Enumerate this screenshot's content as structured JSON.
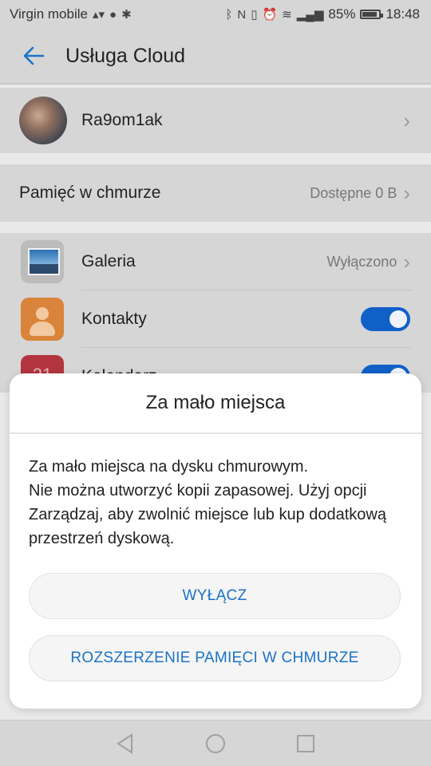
{
  "status_bar": {
    "carrier": "Virgin mobile",
    "battery": "85%",
    "time": "18:48"
  },
  "app_bar": {
    "title": "Usługa Cloud"
  },
  "account": {
    "name": "Ra9om1ak"
  },
  "storage": {
    "label": "Pamięć w chmurze",
    "value": "Dostępne 0 B"
  },
  "apps": [
    {
      "label": "Galeria",
      "status": "Wyłączono",
      "icon": "gallery-icon"
    },
    {
      "label": "Kontakty",
      "toggle": true,
      "icon": "contacts-icon"
    },
    {
      "label": "Kalendarz",
      "toggle": true,
      "icon": "calendar-icon",
      "icon_text": "21"
    }
  ],
  "dialog": {
    "title": "Za mało miejsca",
    "message": "Za mało miejsca na dysku chmurowym.\nNie można utworzyć kopii zapasowej. Użyj opcji Zarządzaj, aby zwolnić miejsce lub kup dodatkową przestrzeń dyskową.",
    "button_disable": "WYŁĄCZ",
    "button_expand": "ROZSZERZENIE PAMIĘCI W CHMURZE"
  },
  "colors": {
    "accent": "#1060c8",
    "dialog_button_text": "#1a73c7"
  }
}
